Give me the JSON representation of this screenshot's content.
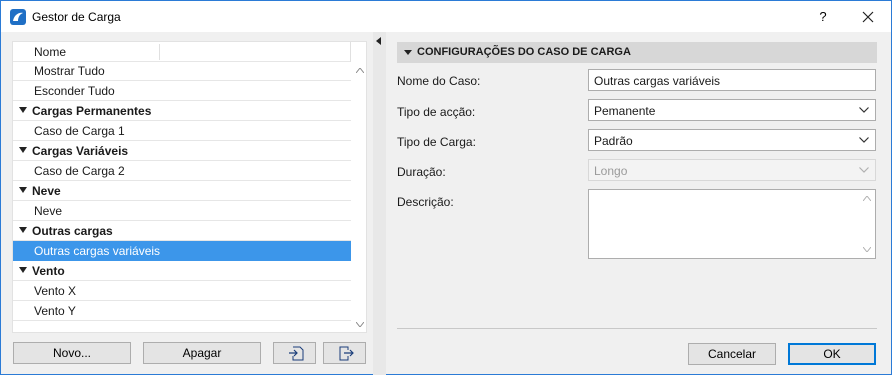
{
  "window": {
    "title": "Gestor de Carga",
    "help_label": "?"
  },
  "list": {
    "column_header": "Nome",
    "rows": [
      {
        "label": "Mostrar Tudo",
        "type": "item"
      },
      {
        "label": "Esconder Tudo",
        "type": "item"
      },
      {
        "label": "Cargas Permanentes",
        "type": "group"
      },
      {
        "label": "Caso de Carga 1",
        "type": "item"
      },
      {
        "label": "Cargas Variáveis",
        "type": "group"
      },
      {
        "label": "Caso de Carga 2",
        "type": "item"
      },
      {
        "label": "Neve",
        "type": "group"
      },
      {
        "label": "Neve",
        "type": "item"
      },
      {
        "label": "Outras cargas",
        "type": "group"
      },
      {
        "label": "Outras cargas variáveis",
        "type": "item",
        "selected": true
      },
      {
        "label": "Vento",
        "type": "group"
      },
      {
        "label": "Vento X",
        "type": "item"
      },
      {
        "label": "Vento Y",
        "type": "item"
      }
    ]
  },
  "buttons": {
    "new": "Novo...",
    "delete": "Apagar",
    "cancel": "Cancelar",
    "ok": "OK"
  },
  "settings": {
    "section_title": "CONFIGURAÇÕES DO CASO DE CARGA",
    "case_name_label": "Nome do Caso:",
    "case_name_value": "Outras cargas variáveis",
    "action_type_label": "Tipo de acção:",
    "action_type_value": "Pemanente",
    "load_type_label": "Tipo de Carga:",
    "load_type_value": "Padrão",
    "duration_label": "Duração:",
    "duration_value": "Longo",
    "description_label": "Descrição:",
    "description_value": ""
  },
  "colors": {
    "selection": "#3c96ea",
    "accent": "#0078d7"
  }
}
